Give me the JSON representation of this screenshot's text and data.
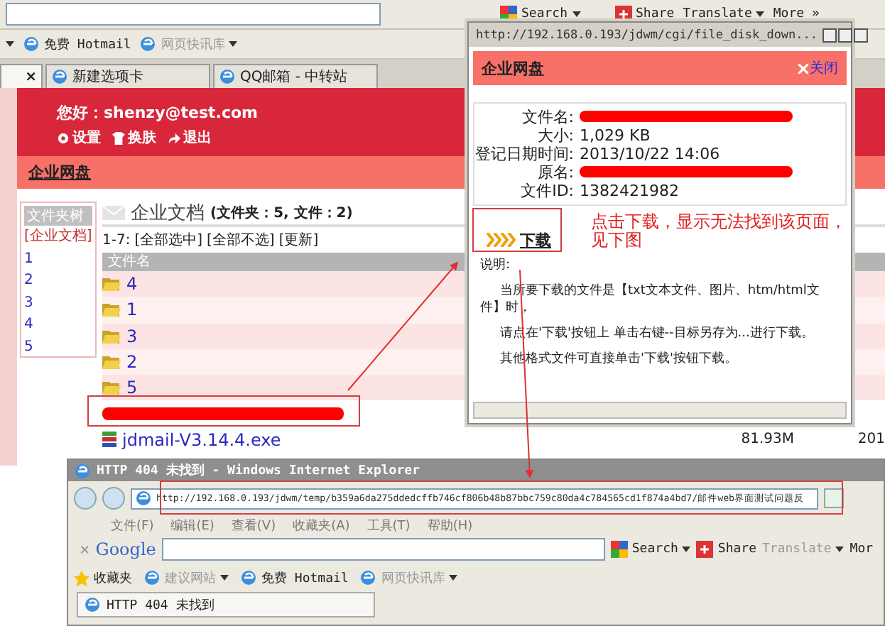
{
  "browser": {
    "toolbar": {
      "search": "Search",
      "share": "Share",
      "translate": "Translate",
      "more": "More »"
    },
    "links": [
      {
        "label": "免费 Hotmail",
        "disabled": false
      },
      {
        "label": "网页快讯库",
        "disabled": true
      }
    ],
    "tabs": [
      {
        "close": "×",
        "selected": true
      },
      {
        "label": "新建选项卡",
        "selected": false
      },
      {
        "label": "QQ邮箱 - 中转站",
        "selected": false
      }
    ]
  },
  "header": {
    "greeting": "您好：shenzy@test.com",
    "actions": [
      {
        "kind": "gear",
        "label": "设置"
      },
      {
        "kind": "shirt",
        "label": "换肤"
      },
      {
        "kind": "exit",
        "label": "退出"
      }
    ]
  },
  "title_bar": "企业网盘",
  "sidebar": {
    "title": "文件夹树",
    "items": [
      {
        "label": "[企业文档]",
        "selected": true
      },
      {
        "label": "1",
        "selected": false
      },
      {
        "label": "2",
        "selected": false
      },
      {
        "label": "3",
        "selected": false
      },
      {
        "label": "4",
        "selected": false
      },
      {
        "label": "5",
        "selected": false
      }
    ]
  },
  "folder": {
    "name": "企业文档",
    "counts": "(文件夹：5, 文件：2)",
    "range": "1-7:",
    "actions": [
      "[全部选中]",
      "[全部不选]",
      "[更新]"
    ]
  },
  "table": {
    "columns": [
      "文件名"
    ],
    "rows": [
      {
        "kind": "folder",
        "name": "4"
      },
      {
        "kind": "folder",
        "name": "1"
      },
      {
        "kind": "folder",
        "name": "3"
      },
      {
        "kind": "folder",
        "name": "2"
      },
      {
        "kind": "folder",
        "name": "5"
      },
      {
        "kind": "redacted"
      },
      {
        "kind": "archive",
        "name": "jdmail-V3.14.4.exe",
        "size": "81.93M",
        "date": "201"
      }
    ]
  },
  "popup": {
    "title": "http://192.168.0.193/jdwm/cgi/file_disk_down...",
    "header": "企业网盘",
    "close": "关闭",
    "fields": [
      {
        "label": "文件名:",
        "redacted": true
      },
      {
        "label": "大小:",
        "redacted": false,
        "value": "1,029 KB"
      },
      {
        "label": "登记日期时间:",
        "redacted": false,
        "value": "2013/10/22 14:06"
      },
      {
        "label": "原名:",
        "redacted": true
      },
      {
        "label": "文件ID:",
        "redacted": false,
        "value": "1382421982"
      }
    ],
    "download": "下载",
    "notes_title": "说明:",
    "notes": [
      "当所要下载的文件是【txt文本文件、图片、htm/html文件】时，",
      "请点在'下载'按钮上 单击右键--目标另存为...进行下载。",
      "其他格式文件可直接单击'下载'按钮下载。"
    ]
  },
  "annotation": "点击下载，显示无法找到该页面，见下图",
  "error_window": {
    "title": "HTTP 404 未找到 - Windows Internet Explorer",
    "address": "http://192.168.0.193/jdwm/temp/b359a6da275ddedcffb746cf806b48b87bbc759c80da4c784565cd1f874a4bd7/邮件web界面测试问题反",
    "menu": [
      "文件(F)",
      "编辑(E)",
      "查看(V)",
      "收藏夹(A)",
      "工具(T)",
      "帮助(H)"
    ],
    "toolbar": {
      "close": "×",
      "logo": "Google",
      "search": "Search",
      "share": "Share",
      "translate": "Translate",
      "more": "Mor"
    },
    "favorites": "收藏夹",
    "links": [
      {
        "label": "建议网站",
        "disabled": true
      },
      {
        "label": "免费 Hotmail",
        "disabled": false
      },
      {
        "label": "网页快讯库",
        "disabled": true
      }
    ],
    "tab": "HTTP 404 未找到"
  }
}
